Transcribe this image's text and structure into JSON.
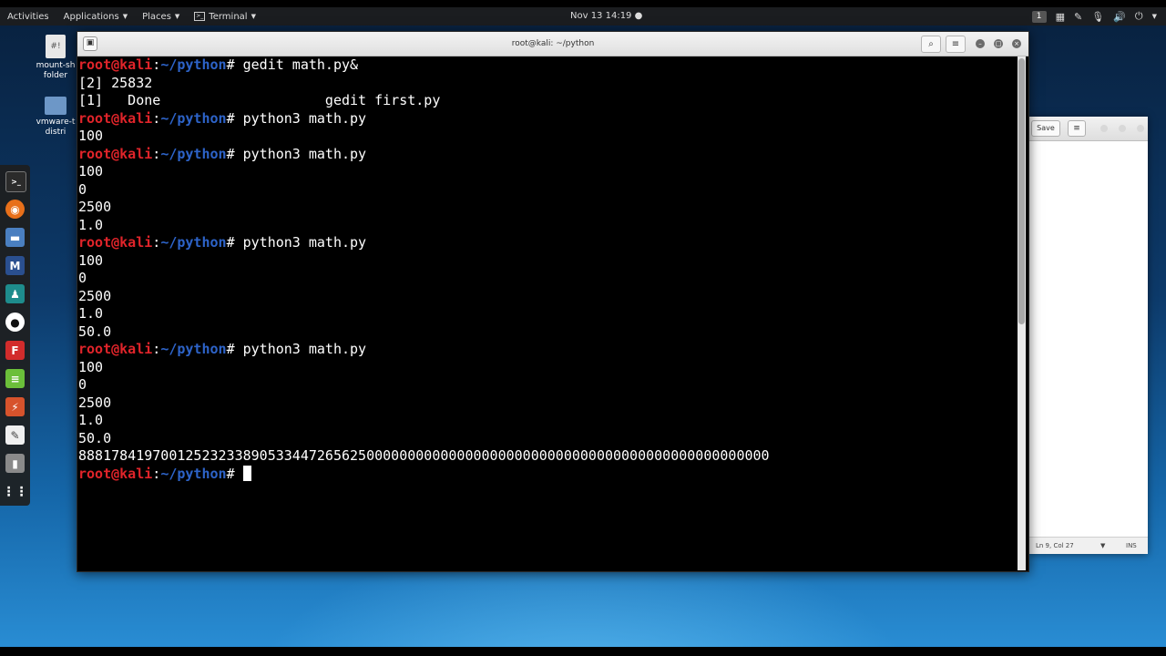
{
  "top_panel": {
    "activities": "Activities",
    "applications": "Applications",
    "places": "Places",
    "terminal_menu": "Terminal",
    "clock": "Nov 13  14:19",
    "workspace_number": "1"
  },
  "desktop_icons": [
    {
      "label_line1": "mount-sh",
      "label_line2": "folder"
    },
    {
      "label_line1": "vmware-t",
      "label_line2": "distri"
    }
  ],
  "terminal": {
    "title": "root@kali: ~/python",
    "prompt_user": "root@kali",
    "prompt_sep": ":",
    "prompt_path": "~/python",
    "prompt_end": "#",
    "lines": [
      {
        "type": "prompt",
        "command": " gedit math.py&"
      },
      {
        "type": "output",
        "text": "[2] 25832"
      },
      {
        "type": "output",
        "text": "[1]   Done                    gedit first.py"
      },
      {
        "type": "prompt",
        "command": " python3 math.py"
      },
      {
        "type": "output",
        "text": "100"
      },
      {
        "type": "prompt",
        "command": " python3 math.py"
      },
      {
        "type": "output",
        "text": "100"
      },
      {
        "type": "output",
        "text": "0"
      },
      {
        "type": "output",
        "text": "2500"
      },
      {
        "type": "output",
        "text": "1.0"
      },
      {
        "type": "prompt",
        "command": " python3 math.py"
      },
      {
        "type": "output",
        "text": "100"
      },
      {
        "type": "output",
        "text": "0"
      },
      {
        "type": "output",
        "text": "2500"
      },
      {
        "type": "output",
        "text": "1.0"
      },
      {
        "type": "output",
        "text": "50.0"
      },
      {
        "type": "prompt",
        "command": " python3 math.py"
      },
      {
        "type": "output",
        "text": "100"
      },
      {
        "type": "output",
        "text": "0"
      },
      {
        "type": "output",
        "text": "2500"
      },
      {
        "type": "output",
        "text": "1.0"
      },
      {
        "type": "output",
        "text": "50.0"
      },
      {
        "type": "output",
        "text": "888178419700125232338905334472656250000000000000000000000000000000000000000000000000"
      },
      {
        "type": "prompt_active",
        "command": " "
      }
    ]
  },
  "gedit": {
    "save_label": "Save",
    "status_position": "Ln 9, Col 27",
    "status_mode": "INS"
  },
  "colors": {
    "prompt_user": "#e0242a",
    "prompt_path": "#2d63c8",
    "terminal_bg": "#000000"
  }
}
